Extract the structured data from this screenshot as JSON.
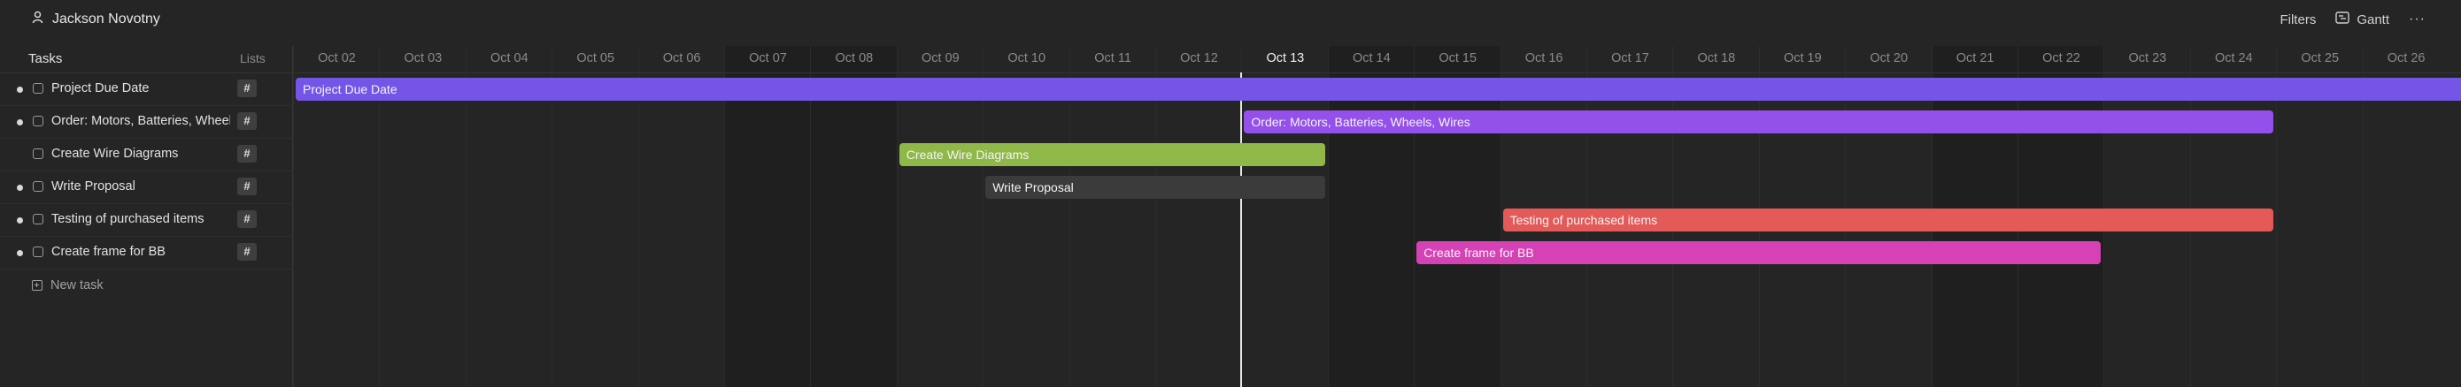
{
  "header": {
    "owner_name": "Jackson Novotny",
    "filters_label": "Filters",
    "view_label": "Gantt",
    "more_label": "···"
  },
  "left_panel": {
    "tasks_header": "Tasks",
    "lists_header": "Lists",
    "tasks": [
      {
        "name": "Project Due Date",
        "tag": "#",
        "dot": true
      },
      {
        "name": "Order: Motors, Batteries, Wheels, Wires",
        "tag": "#",
        "dot": true
      },
      {
        "name": "Create Wire Diagrams",
        "tag": "#",
        "dot": false
      },
      {
        "name": "Write Proposal",
        "tag": "#",
        "dot": true
      },
      {
        "name": "Testing of purchased items",
        "tag": "#",
        "dot": true
      },
      {
        "name": "Create frame for BB",
        "tag": "#",
        "dot": true
      }
    ],
    "new_task_label": "New task"
  },
  "timeline": {
    "days": [
      {
        "label": "Oct 02",
        "weekend": false
      },
      {
        "label": "Oct 03",
        "weekend": false
      },
      {
        "label": "Oct 04",
        "weekend": false
      },
      {
        "label": "Oct 05",
        "weekend": false
      },
      {
        "label": "Oct 06",
        "weekend": false
      },
      {
        "label": "Oct 07",
        "weekend": true
      },
      {
        "label": "Oct 08",
        "weekend": true
      },
      {
        "label": "Oct 09",
        "weekend": false
      },
      {
        "label": "Oct 10",
        "weekend": false
      },
      {
        "label": "Oct 11",
        "weekend": false
      },
      {
        "label": "Oct 12",
        "weekend": false
      },
      {
        "label": "Oct 13",
        "weekend": false,
        "today": true
      },
      {
        "label": "Oct 14",
        "weekend": true
      },
      {
        "label": "Oct 15",
        "weekend": true
      },
      {
        "label": "Oct 16",
        "weekend": false
      },
      {
        "label": "Oct 17",
        "weekend": false
      },
      {
        "label": "Oct 18",
        "weekend": false
      },
      {
        "label": "Oct 19",
        "weekend": false
      },
      {
        "label": "Oct 20",
        "weekend": false
      },
      {
        "label": "Oct 21",
        "weekend": true
      },
      {
        "label": "Oct 22",
        "weekend": true
      },
      {
        "label": "Oct 23",
        "weekend": false
      },
      {
        "label": "Oct 24",
        "weekend": false
      },
      {
        "label": "Oct 25",
        "weekend": false
      },
      {
        "label": "Oct 26",
        "weekend": false
      }
    ],
    "bars": [
      {
        "label": "Project Due Date",
        "start": "Oct 02",
        "end": "Oct 26",
        "row": 0,
        "color": "#7455e8",
        "open_end": true
      },
      {
        "label": "Order: Motors, Batteries, Wheels, Wires",
        "start": "Oct 13",
        "end": "Oct 24",
        "row": 1,
        "color": "#9450ea"
      },
      {
        "label": "Create Wire Diagrams",
        "start": "Oct 09",
        "end": "Oct 13",
        "row": 2,
        "color": "#90b848"
      },
      {
        "label": "Write Proposal",
        "start": "Oct 10",
        "end": "Oct 13",
        "row": 3,
        "color": "#3b3b3b"
      },
      {
        "label": "Testing of purchased items",
        "start": "Oct 16",
        "end": "Oct 24",
        "row": 4,
        "color": "#e35a58"
      },
      {
        "label": "Create frame for BB",
        "start": "Oct 15",
        "end": "Oct 22",
        "row": 5,
        "color": "#d641b6"
      }
    ]
  }
}
